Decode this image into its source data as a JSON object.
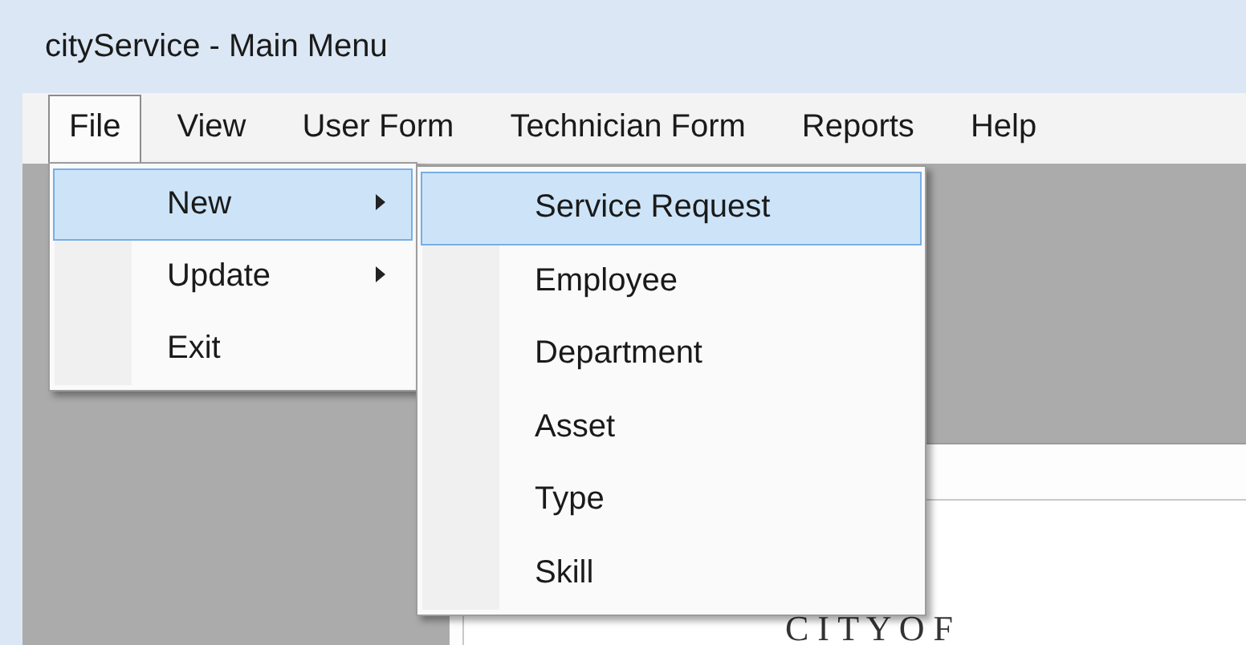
{
  "window": {
    "title": "cityService - Main Menu"
  },
  "menu_bar": [
    {
      "label": "File",
      "selected": true
    },
    {
      "label": "View",
      "selected": false
    },
    {
      "label": "User Form",
      "selected": false
    },
    {
      "label": "Technician Form",
      "selected": false
    },
    {
      "label": "Reports",
      "selected": false
    },
    {
      "label": "Help",
      "selected": false
    }
  ],
  "file_menu": [
    {
      "label": "New",
      "selected": true,
      "submenu": true
    },
    {
      "label": "Update",
      "selected": false,
      "submenu": true
    },
    {
      "label": "Exit",
      "selected": false,
      "submenu": false
    }
  ],
  "new_submenu": [
    {
      "label": "Service Request",
      "selected": true
    },
    {
      "label": "Employee",
      "selected": false
    },
    {
      "label": "Department",
      "selected": false
    },
    {
      "label": "Asset",
      "selected": false
    },
    {
      "label": "Type",
      "selected": false
    },
    {
      "label": "Skill",
      "selected": false
    }
  ],
  "form": {
    "logo_text": "C I T Y   O F"
  }
}
